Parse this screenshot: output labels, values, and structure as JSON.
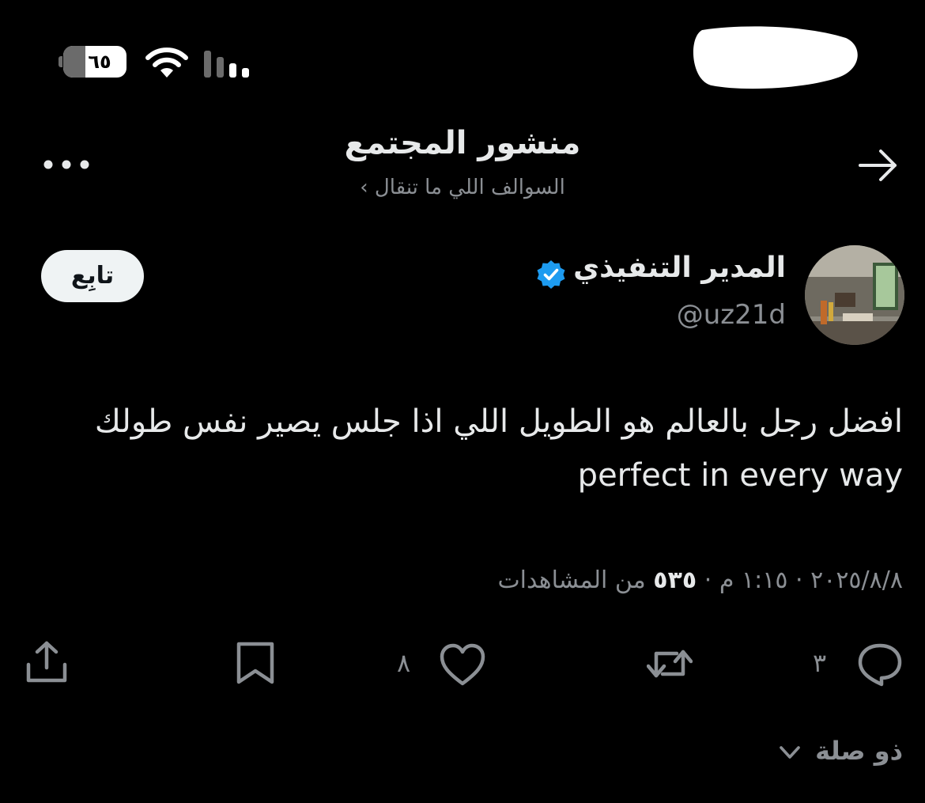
{
  "status_bar": {
    "battery_level": "٦٥",
    "battery_fraction": 0.65,
    "signal_icon": "cellular-signal-icon",
    "wifi_icon": "wifi-icon"
  },
  "header": {
    "title": "منشور المجتمع",
    "community_link": "السوالف اللي ما تنقال ›",
    "back_icon": "arrow-right-icon",
    "more_icon": "more-horizontal-icon"
  },
  "author": {
    "name": "المدير التنفيذي",
    "handle": "@uz21d",
    "verified": true,
    "follow_label": "تابِع"
  },
  "post": {
    "line1": "افضل رجل بالعالم هو الطويل اللي اذا جلس يصير نفس طولك",
    "line2": "perfect in every way",
    "date": "٢٠٢٥/٨/٨",
    "time": "١:١٥ م",
    "views_count": "٥٣٥",
    "views_label": "من المشاهدات",
    "separator": "·"
  },
  "actions": {
    "reply_count": "٣",
    "repost_count": "",
    "like_count": "٨",
    "bookmark_count": "",
    "share_icon": "share-icon"
  },
  "thread_toggle": {
    "label": "ذو صلة"
  },
  "colors": {
    "background": "#000000",
    "primary_text": "#e7e9ea",
    "secondary_text": "#8b8f94",
    "verified_blue": "#1d9bf0",
    "follow_bg": "#eff3f4"
  }
}
